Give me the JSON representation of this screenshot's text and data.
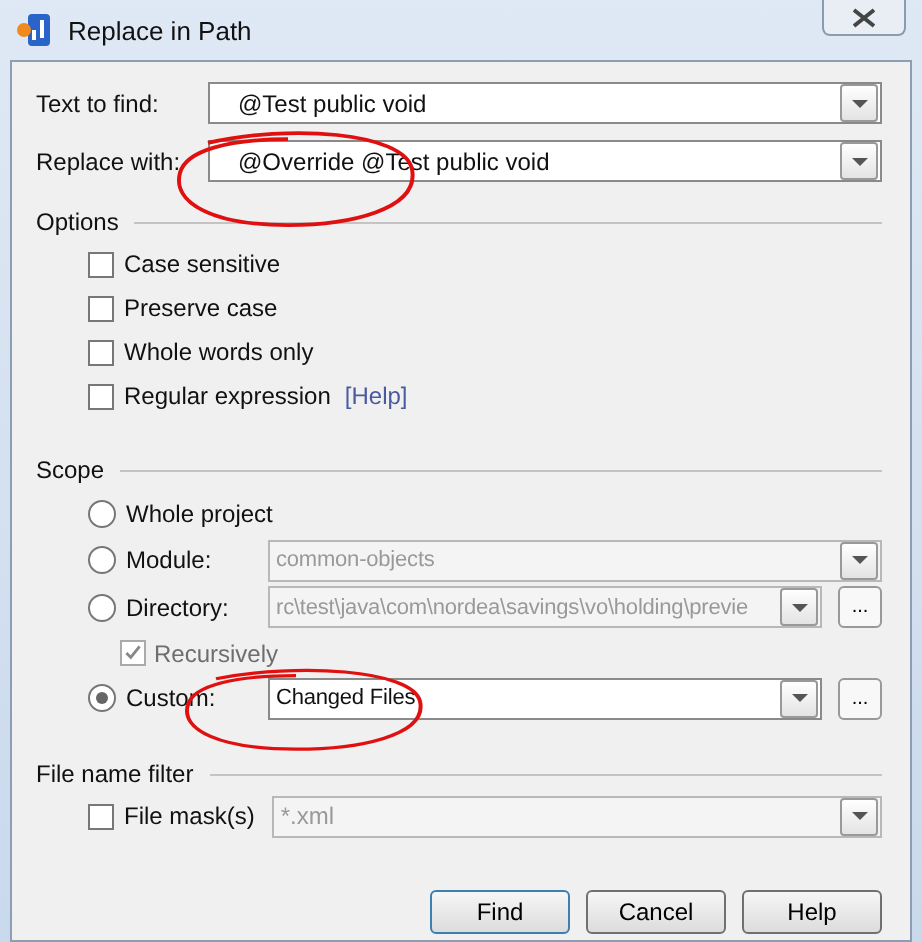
{
  "window": {
    "title": "Replace in Path"
  },
  "find": {
    "label": "Text to find:",
    "value": "@Test public void"
  },
  "replace": {
    "label": "Replace with:",
    "value": "@Override @Test public void"
  },
  "options": {
    "title": "Options",
    "items": [
      {
        "label": "Case sensitive",
        "checked": false
      },
      {
        "label": "Preserve case",
        "checked": false
      },
      {
        "label": "Whole words only",
        "checked": false
      },
      {
        "label": "Regular expression",
        "checked": false,
        "link": "[Help]"
      }
    ]
  },
  "scope": {
    "title": "Scope",
    "items": [
      {
        "kind": "plain",
        "label": "Whole project",
        "selected": false
      },
      {
        "kind": "combo",
        "label": "Module:",
        "selected": false,
        "value": "common-objects",
        "disabled": true
      },
      {
        "kind": "combo_browse",
        "label": "Directory:",
        "selected": false,
        "value": "rc\\test\\java\\com\\nordea\\savings\\vo\\holding\\previe",
        "disabled": true,
        "browse": "...",
        "sub": {
          "label": "Recursively",
          "checked": true,
          "disabled": true
        }
      },
      {
        "kind": "combo_browse",
        "label": "Custom:",
        "selected": true,
        "value": "Changed Files",
        "disabled": false,
        "browse": "..."
      }
    ]
  },
  "filter": {
    "title": "File name filter",
    "label": "File mask(s)",
    "checked": false,
    "value": "*.xml",
    "disabled": true
  },
  "buttons": [
    "Find",
    "Cancel",
    "Help"
  ],
  "annotations": [
    {
      "kind": "circle"
    },
    {
      "kind": "circle"
    }
  ]
}
